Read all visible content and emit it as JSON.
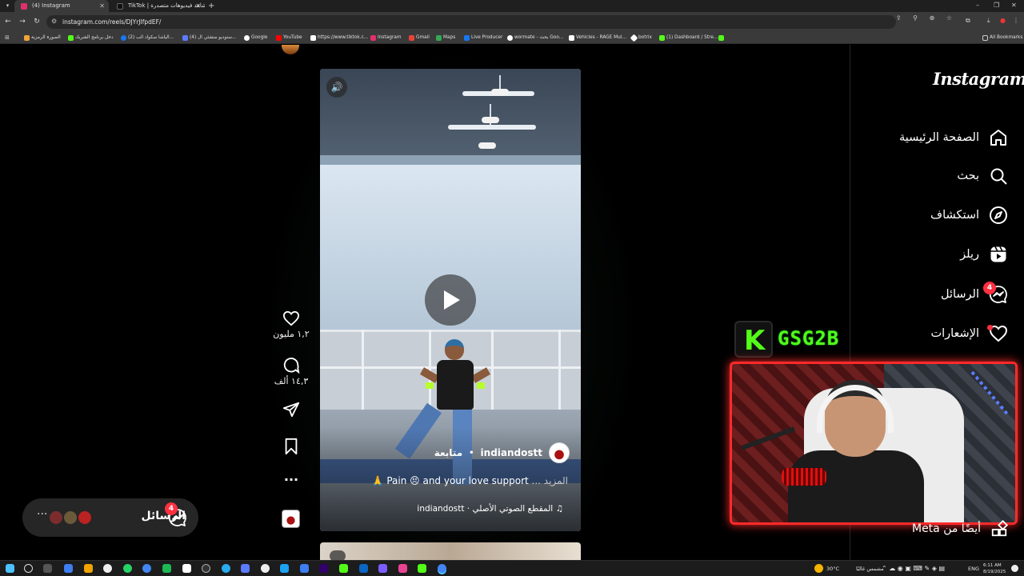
{
  "browser": {
    "tabs": [
      {
        "title": "(4) Instagram",
        "favicon_color": "#e1306c",
        "active": true
      },
      {
        "title": "TikTok | شاهد فيديوهات متصدرة",
        "favicon_color": "#111111",
        "active": false
      }
    ],
    "url": "instagram.com/reels/DJYrJIfpdEF/",
    "bookmarks": [
      {
        "label": "الصورة الرمزية",
        "color": "#f2a33a"
      },
      {
        "label": "دخل برنامج الشريك",
        "color": "#53fc18"
      },
      {
        "label": "(2) الياشا سكواد الب...",
        "color": "#1877f2"
      },
      {
        "label": "(4) ستوديو منشئي ال...",
        "color": "#5b7cff"
      },
      {
        "label": "Google",
        "color": "#ffffff"
      },
      {
        "label": "YouTube",
        "color": "#ff0000"
      },
      {
        "label": "https://www.tiktok.c...",
        "color": "#ffffff"
      },
      {
        "label": "Instagram",
        "color": "#e1306c"
      },
      {
        "label": "Gmail",
        "color": "#ea4335"
      },
      {
        "label": "Maps",
        "color": "#34a853"
      },
      {
        "label": "Live Producer",
        "color": "#1877f2"
      },
      {
        "label": "wormate - بحث Goo...",
        "color": "#ffffff"
      },
      {
        "label": "Vehicles - RAGE Mul...",
        "color": "#ffffff"
      },
      {
        "label": "botrix",
        "color": "#ffffff"
      },
      {
        "label": "(1) Dashboard / Stre...",
        "color": "#53fc18"
      }
    ],
    "all_bookmarks": "All Bookmarks"
  },
  "sidebar": {
    "logo": "Instagram",
    "items": [
      {
        "label": "الصفحة الرئيسية",
        "icon": "home-icon"
      },
      {
        "label": "بحث",
        "icon": "search-icon"
      },
      {
        "label": "استكشاف",
        "icon": "explore-icon"
      },
      {
        "label": "ريلز",
        "icon": "reels-icon"
      },
      {
        "label": "الرسائل",
        "icon": "messenger-icon",
        "badge": "4"
      },
      {
        "label": "الإشعارات",
        "icon": "heart-icon"
      }
    ],
    "also_from": "أيضًا من Meta"
  },
  "reel": {
    "author": "indiandostt",
    "follow": "متابعة",
    "caption": "Pain 😣 and your love support 🙏",
    "more": "المزيد ...",
    "audio": "المقطع الصوتي الأصلي · indiandostt",
    "likes": "١,٢ مليون",
    "comments": "١٤,٣ ألف"
  },
  "messages_pill": {
    "label": "الرسائل",
    "badge": "4"
  },
  "stream_overlay": {
    "name": "GSG2B",
    "kick_letter": "K"
  },
  "taskbar": {
    "weather": "30°C",
    "weather_desc": "مشمس غالبًا",
    "lang": "ENG",
    "time": "6:11 AM",
    "date": "8/19/2025"
  },
  "colors": {
    "accent": "#ff3040",
    "kick_green": "#53fc18",
    "stream_red": "#ff2a2a"
  }
}
